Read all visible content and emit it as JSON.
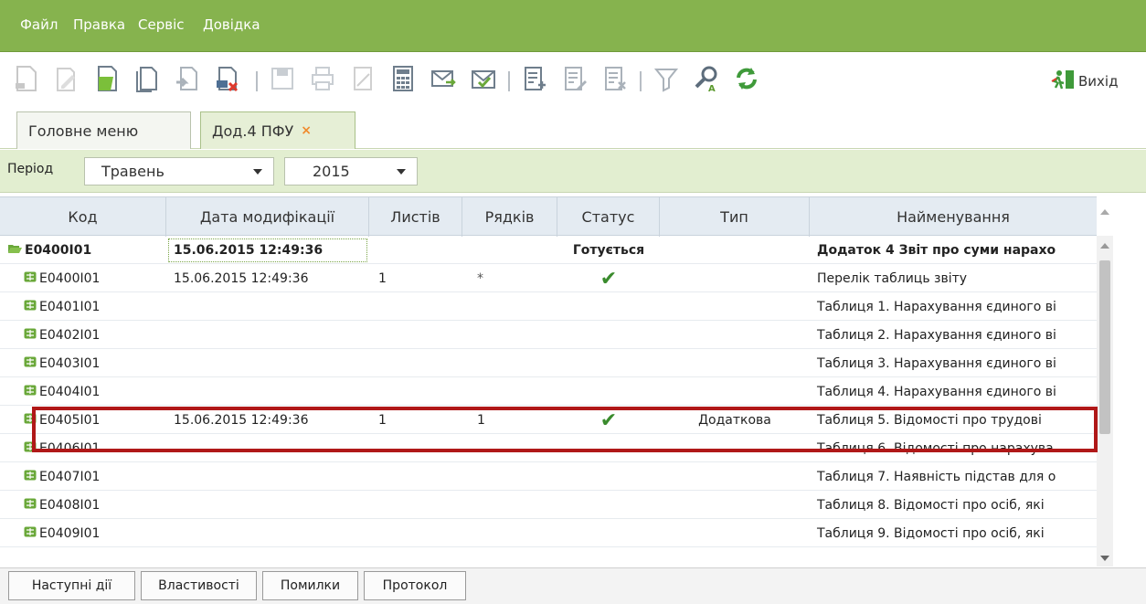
{
  "menu": [
    "Файл",
    "Правка",
    "Сервіс",
    "Довідка"
  ],
  "toolbar": {
    "exit_label": "Вихід",
    "icons": [
      "new-doc-icon",
      "edit-doc-icon",
      "open-doc-icon",
      "copy-doc-icon",
      "import-doc-icon",
      "delete-doc-icon",
      "save-icon",
      "print-icon",
      "sign-icon",
      "calculator-icon",
      "send-mail-icon",
      "receive-mail-icon",
      "add-row-icon",
      "edit-row-icon",
      "delete-row-icon",
      "filter-icon",
      "search-icon",
      "refresh-icon"
    ]
  },
  "tabs": [
    {
      "label": "Головне меню"
    },
    {
      "label": "Дод.4 ПФУ",
      "close": "×"
    }
  ],
  "period": {
    "label": "Період",
    "month": "Травень",
    "year": "2015"
  },
  "grid": {
    "columns": [
      "Код",
      "Дата модифікації",
      "Листів",
      "Рядків",
      "Статус",
      "Тип",
      "Найменування"
    ],
    "rows": [
      {
        "code": "E0400I01",
        "date": "15.06.2015 12:49:36",
        "sheets": "",
        "lines": "",
        "status": "Готується",
        "type": "",
        "name": "Додаток 4 Звіт про суми нарахо",
        "parent": true
      },
      {
        "code": "E0400I01",
        "date": "15.06.2015 12:49:36",
        "sheets": "1",
        "lines": "*",
        "status": "✔",
        "type": "",
        "name": "Перелік таблиць звіту"
      },
      {
        "code": "E0401I01",
        "date": "",
        "sheets": "",
        "lines": "",
        "status": "",
        "type": "",
        "name": "Таблиця 1. Нарахування єдиного ві"
      },
      {
        "code": "E0402I01",
        "date": "",
        "sheets": "",
        "lines": "",
        "status": "",
        "type": "",
        "name": "Таблиця 2. Нарахування єдиного ві"
      },
      {
        "code": "E0403I01",
        "date": "",
        "sheets": "",
        "lines": "",
        "status": "",
        "type": "",
        "name": "Таблиця 3. Нарахування єдиного ві"
      },
      {
        "code": "E0404I01",
        "date": "",
        "sheets": "",
        "lines": "",
        "status": "",
        "type": "",
        "name": "Таблиця 4. Нарахування єдиного ві"
      },
      {
        "code": "E0405I01",
        "date": "15.06.2015 12:49:36",
        "sheets": "1",
        "lines": "1",
        "status": "✔",
        "type": "Додаткова",
        "name": "Таблиця 5. Відомості про трудові"
      },
      {
        "code": "E0406I01",
        "date": "",
        "sheets": "",
        "lines": "",
        "status": "",
        "type": "",
        "name": "Таблиця 6. Відомості про нарахува"
      },
      {
        "code": "E0407I01",
        "date": "",
        "sheets": "",
        "lines": "",
        "status": "",
        "type": "",
        "name": "Таблиця 7. Наявність підстав для о"
      },
      {
        "code": "E0408I01",
        "date": "",
        "sheets": "",
        "lines": "",
        "status": "",
        "type": "",
        "name": "Таблиця 8. Відомості про осіб, які"
      },
      {
        "code": "E0409I01",
        "date": "",
        "sheets": "",
        "lines": "",
        "status": "",
        "type": "",
        "name": "Таблиця 9. Відомості про осіб, які"
      }
    ]
  },
  "bottom_tabs": [
    "Наступні дії",
    "Властивості",
    "Помилки",
    "Протокол"
  ],
  "colors": {
    "menubar": "#86b34e",
    "period_bar": "#e2eed0",
    "highlight": "#b01818",
    "check": "#3a8b2d"
  }
}
